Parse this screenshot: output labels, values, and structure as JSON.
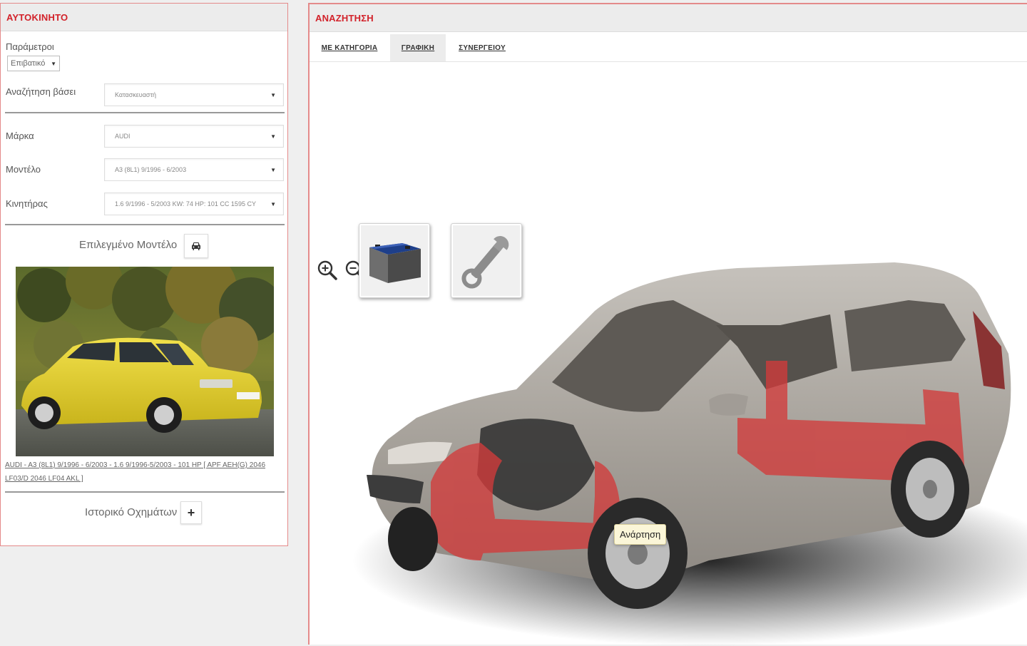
{
  "left_panel": {
    "title": "ΑΥΤΟΚΙΝΗΤΟ",
    "params_label": "Παράμετροι",
    "params_value": "Επιβατικό",
    "search_label": "Αναζήτηση βάσει",
    "search_value": "Κατασκευαστή",
    "make_label": "Μάρκα",
    "make_value": "AUDI",
    "model_label": "Μοντέλο",
    "model_value": "A3 (8L1) 9/1996 - 6/2003",
    "engine_label": "Κινητήρας",
    "engine_value": "1.6 9/1996 - 5/2003 KW: 74 HP: 101 CC 1595 CY",
    "selected_model_title": "Επιλεγμένο Μοντέλο",
    "vehicle_description": "AUDI - A3 (8L1) 9/1996 - 6/2003 - 1.6 9/1996-5/2003 - 101 HP [ APF AEH(G) 2046 LF03/D 2046 LF04 AKL ]",
    "history_label": "Ιστορικό Οχημάτων"
  },
  "right_panel": {
    "title": "ΑΝΑΖΗΤΗΣΗ",
    "tabs": [
      {
        "label": "ΜΕ ΚΑΤΗΓΟΡΙΑ"
      },
      {
        "label": "ΓΡΑΦΙΚΗ"
      },
      {
        "label": "ΣΥΝΕΡΓΕΙΟΥ"
      }
    ],
    "active_tab": "ΓΡΑΦΙΚΗ",
    "tooltip": "Ανάρτηση"
  },
  "colors": {
    "accent": "#d2222a",
    "panel_border": "#e48a8a",
    "highlight_part": "#d23b3b",
    "car_body": "#a9a49d"
  }
}
